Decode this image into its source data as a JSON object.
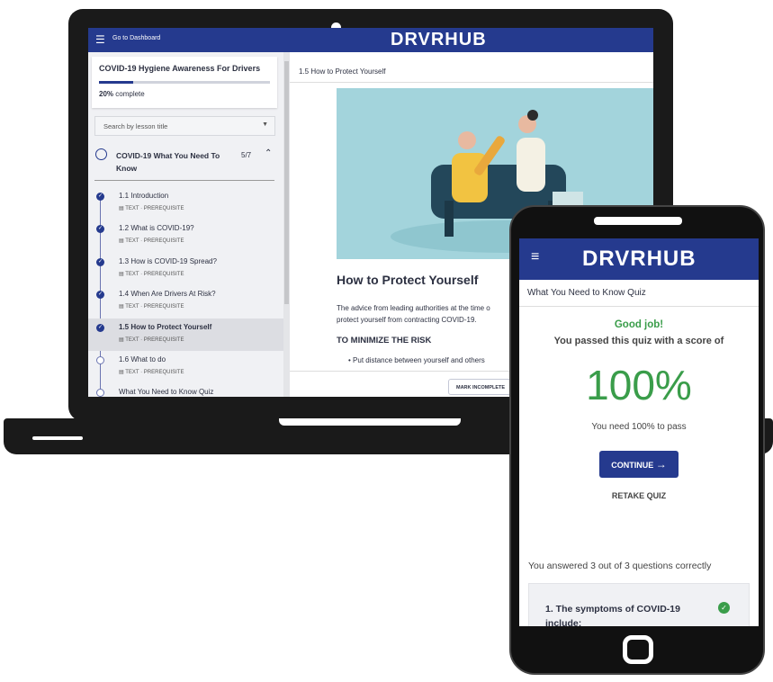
{
  "brand": "DRVRHUB",
  "laptop": {
    "header": {
      "dashboard_link": "Go to Dashboard",
      "menu_icon": "collapse-menu-icon"
    },
    "course": {
      "title": "COVID-19 Hygiene Awareness For Drivers",
      "progress_percent": 20,
      "progress_label": "20%",
      "progress_suffix": "complete"
    },
    "search": {
      "placeholder": "Search by lesson title"
    },
    "module": {
      "title": "COVID-19 What You Need To Know",
      "count": "5/7"
    },
    "lessons": [
      {
        "title": "1.1 Introduction",
        "meta": "TEXT · PREREQUISITE",
        "status": "complete"
      },
      {
        "title": "1.2 What is COVID-19?",
        "meta": "TEXT · PREREQUISITE",
        "status": "complete"
      },
      {
        "title": "1.3 How is COVID-19 Spread?",
        "meta": "TEXT · PREREQUISITE",
        "status": "complete"
      },
      {
        "title": "1.4 When Are Drivers At Risk?",
        "meta": "TEXT · PREREQUISITE",
        "status": "complete"
      },
      {
        "title": "1.5 How to Protect Yourself",
        "meta": "TEXT · PREREQUISITE",
        "status": "complete",
        "active": true
      },
      {
        "title": "1.6 What to do",
        "meta": "TEXT · PREREQUISITE",
        "status": "incomplete"
      },
      {
        "title": "What You Need to Know Quiz",
        "meta": "",
        "status": "incomplete"
      }
    ],
    "content": {
      "breadcrumb": "1.5 How to Protect Yourself",
      "heading": "How to Protect Yourself",
      "paragraph_line1": "The advice from leading authorities at the time o",
      "paragraph_line2": "protect yourself from contracting COVID-19.",
      "subheading": "TO MINIMIZE THE RISK",
      "bullet": "Put distance between yourself and others",
      "mark_button": "MARK INCOMPLETE"
    }
  },
  "phone": {
    "menu_icon": "hamburger-icon",
    "quiz_title": "What You Need to Know Quiz",
    "good_job": "Good job!",
    "passed_text": "You passed this quiz with a score of",
    "score": "100%",
    "pass_requirement": "You need 100% to pass",
    "continue_button": "CONTINUE",
    "retake_button": "RETAKE QUIZ",
    "summary": "You answered 3 out of 3 questions correctly",
    "question_1": "1. The symptoms of COVID-19 include:"
  },
  "colors": {
    "brand_blue": "#253a8e",
    "success_green": "#3a9d4a",
    "illustration_bg": "#a3d4dc"
  }
}
